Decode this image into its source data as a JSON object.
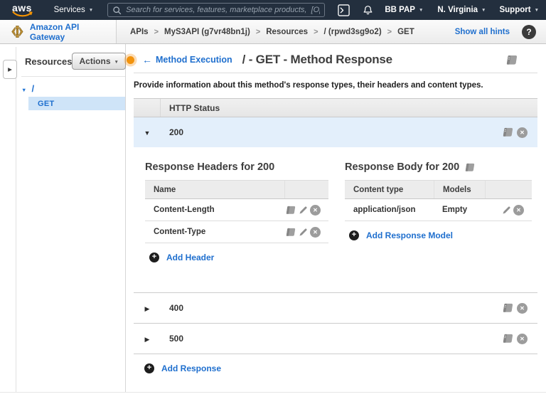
{
  "topnav": {
    "logo_text": "aws",
    "services_label": "Services",
    "search_placeholder": "Search for services, features, marketplace products,  [Option+S]",
    "account_label": "BB PAP",
    "region_label": "N. Virginia",
    "support_label": "Support"
  },
  "subnav": {
    "app_title": "Amazon API Gateway",
    "separator": ">",
    "breadcrumb": [
      "APIs",
      "MyS3API (g7vr48bn1j)",
      "Resources",
      "/ (rpwd3sg9o2)",
      "GET"
    ],
    "show_hints_label": "Show all hints",
    "help_label": "?"
  },
  "sidebar": {
    "title": "Resources",
    "actions_label": "Actions",
    "root_item": "/",
    "method_item": "GET"
  },
  "main": {
    "back_link_label": "Method Execution",
    "page_title": "/ - GET - Method Response",
    "description": "Provide information about this method's response types, their headers and content types.",
    "status_table": {
      "header": "HTTP Status",
      "expanded_row": "200",
      "collapsed_rows": [
        "400",
        "500"
      ],
      "add_response_label": "Add Response"
    },
    "headers_panel": {
      "title": "Response Headers for 200",
      "name_header": "Name",
      "rows": [
        "Content-Length",
        "Content-Type"
      ],
      "add_label": "Add Header"
    },
    "body_panel": {
      "title": "Response Body for 200",
      "content_type_header": "Content type",
      "models_header": "Models",
      "rows": [
        {
          "content_type": "application/json",
          "model": "Empty"
        }
      ],
      "add_label": "Add Response Model"
    }
  },
  "colors": {
    "topnav_bg": "#232f3e",
    "link_blue": "#1f6fce",
    "selected_row_bg": "#e3effb",
    "tree_selected_bg": "#cfe4f8",
    "hint_orange": "#f2930d",
    "aws_smile_orange": "#f79400",
    "api_gateway_gold": "#bf9136"
  }
}
